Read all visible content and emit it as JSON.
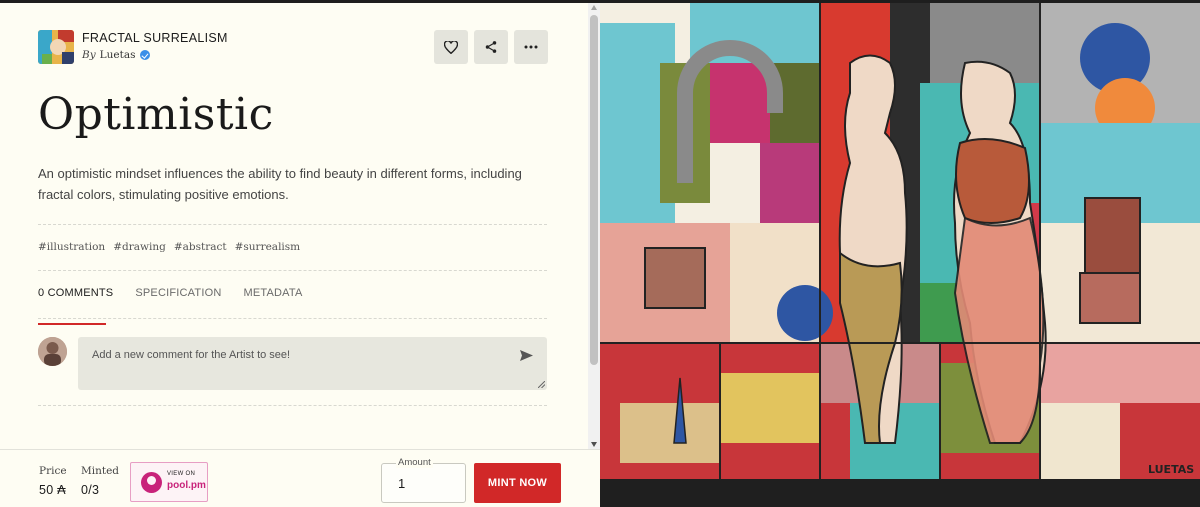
{
  "collection": {
    "name": "FRACTAL SURREALISM",
    "by_prefix": "By",
    "artist": "Luetas"
  },
  "artwork": {
    "title": "Optimistic",
    "description": "An optimistic mindset influences the ability to find beauty in different forms, including fractal colors, stimulating positive emotions.",
    "signature": "LUETAS"
  },
  "tags": [
    "#illustration",
    "#drawing",
    "#abstract",
    "#surrealism"
  ],
  "tabs": [
    "0 COMMENTS",
    "SPECIFICATION",
    "METADATA"
  ],
  "active_tab": "0 COMMENTS",
  "comment": {
    "placeholder": "Add a new comment for the Artist to see!"
  },
  "footer": {
    "price_label": "Price",
    "price_value": "50 ₳",
    "minted_label": "Minted",
    "minted_value": "0/3",
    "pool_view_on": "VIEW ON",
    "pool_brand": "pool.pm",
    "amount_label": "Amount",
    "amount_value": "1",
    "mint_label": "MINT NOW"
  },
  "icons": [
    "heart-icon",
    "share-icon",
    "more-icon",
    "send-icon",
    "verified-icon"
  ],
  "colors": {
    "accent": "#d12828",
    "background": "#fefdf3",
    "pool_brand": "#c8237a"
  }
}
